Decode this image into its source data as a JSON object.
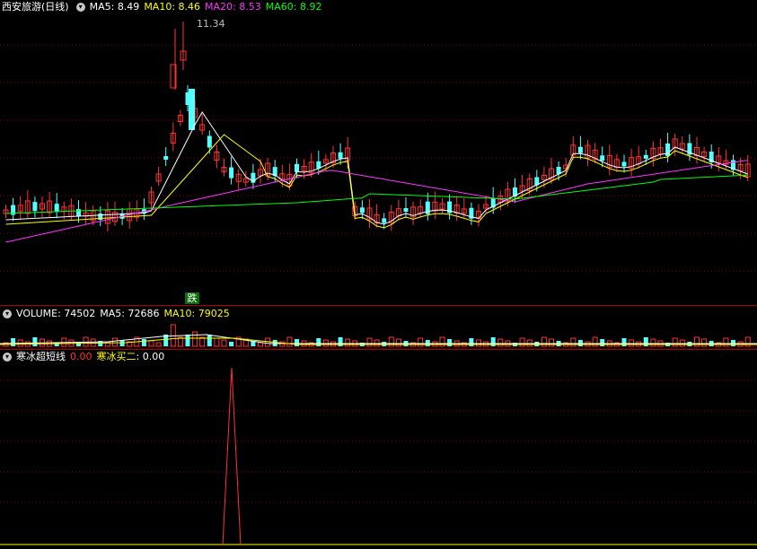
{
  "main": {
    "title": "西安旅游(日线)",
    "indicators": [
      {
        "label": "MA5: ",
        "value": "8.49",
        "color": "#ffffff"
      },
      {
        "label": "MA10: ",
        "value": "8.46",
        "color": "#ffff00"
      },
      {
        "label": "MA20: ",
        "value": "8.53",
        "color": "#ff33ff"
      },
      {
        "label": "MA60: ",
        "value": "8.92",
        "color": "#00ff00"
      }
    ],
    "high_label": "11.34",
    "marker": "跌"
  },
  "volume": {
    "title": "VOLUME: 74502",
    "ma5": "MA5: 72686",
    "ma10": "MA10: 79025"
  },
  "indicator": {
    "title": "寒冰超短线",
    "v1_value": "0.00",
    "v2_label": "寒冰买二",
    "v2_value": "0.00"
  },
  "colors": {
    "up": "#ff3232",
    "down": "#54ffff",
    "ma5": "#ffffff",
    "ma10": "#ffff00",
    "ma20": "#ff33ff",
    "ma60": "#00ff00",
    "grid": "#8b0000"
  }
}
